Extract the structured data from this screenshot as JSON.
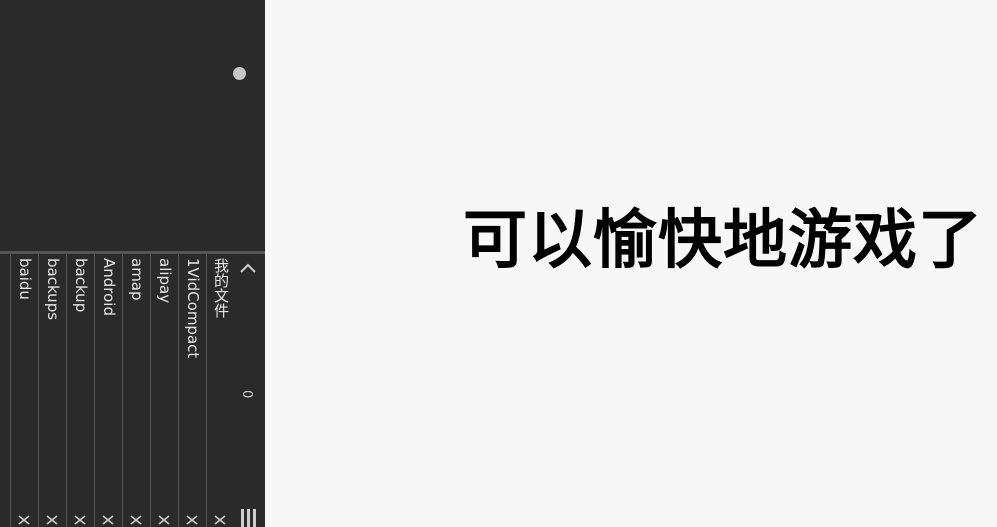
{
  "left_panel": {
    "folders": [
      {
        "label": "我的文件"
      },
      {
        "label": "1VidCompact"
      },
      {
        "label": "alipay"
      },
      {
        "label": "amap"
      },
      {
        "label": "Android"
      },
      {
        "label": "backup"
      },
      {
        "label": "backups"
      },
      {
        "label": "baidu"
      }
    ],
    "count": "0"
  },
  "headline": "可以愉快地游戏了",
  "colors": {
    "panel_bg": "#2a2a2a",
    "page_bg": "#f7f7f7",
    "text_light": "#e6e6e6",
    "headline": "#000000"
  }
}
